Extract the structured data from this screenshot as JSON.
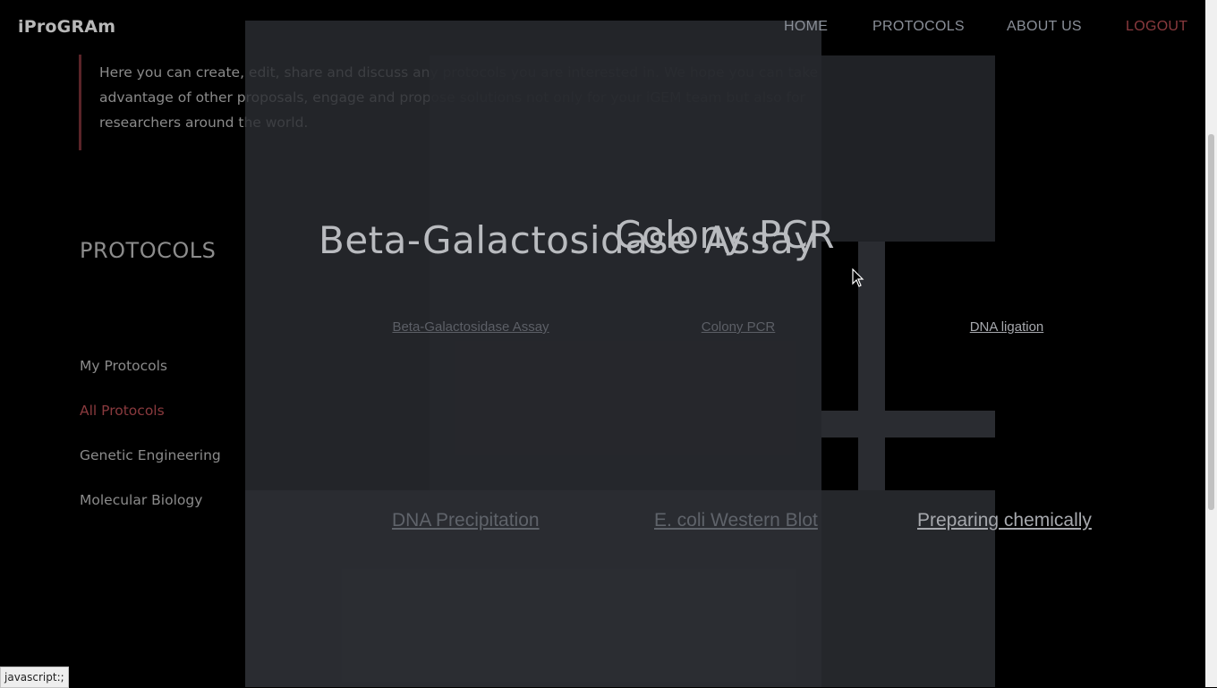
{
  "nav": {
    "brand": "iProGRAm",
    "items": [
      "HOME",
      "PROTOCOLS",
      "ABOUT US",
      "LOGOUT"
    ]
  },
  "intro": {
    "text": "Here you can create, edit, share and discuss any protocols you are interested in. We hope you can take advantage of other proposals, engage and propose solutions not only for your iGEM team but also for researchers around the world."
  },
  "sidebar": {
    "heading": "PROTOCOLS",
    "items": [
      "My Protocols",
      "All Protocols",
      "Genetic Engineering",
      "Molecular Biology"
    ],
    "active": "All Protocols"
  },
  "tiles": {
    "row1": [
      "Beta-Galactosidase Assay",
      "Colony PCR",
      "DNA ligation"
    ],
    "row2": [
      "DNA Precipitation",
      "E. coli Western Blot",
      "Preparing chemically"
    ]
  },
  "drag_titles": [
    "Beta-Galactosidase Assay",
    "Colony PCR"
  ],
  "status": "javascript:;",
  "colors": {
    "accent": "#8a3a3e",
    "background": "#000000"
  }
}
